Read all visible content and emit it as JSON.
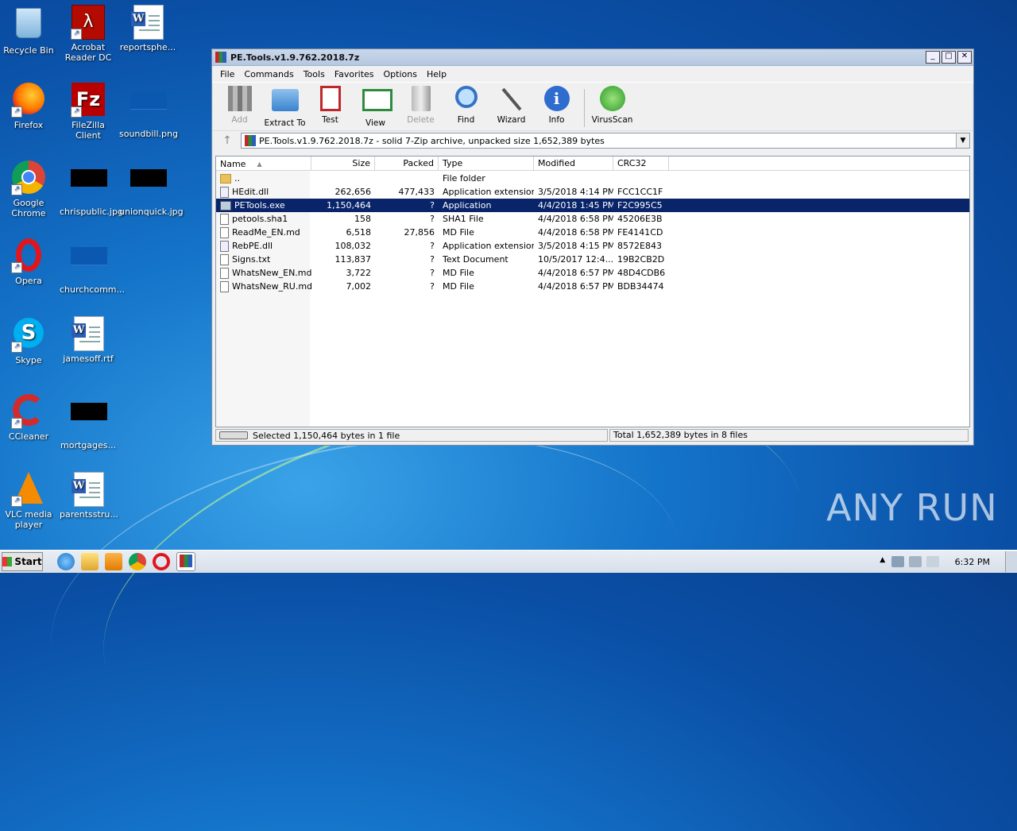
{
  "desktop": {
    "icons": [
      {
        "label": "Recycle Bin"
      },
      {
        "label": "Acrobat Reader DC"
      },
      {
        "label": "reportsphe..."
      },
      {
        "label": "Firefox"
      },
      {
        "label": "FileZilla Client"
      },
      {
        "label": "soundbill.png"
      },
      {
        "label": "Google Chrome"
      },
      {
        "label": "chrispublic.jpg"
      },
      {
        "label": "unionquick.jpg"
      },
      {
        "label": "Opera"
      },
      {
        "label": "churchcomm..."
      },
      {
        "label": "Skype"
      },
      {
        "label": "jamesoff.rtf"
      },
      {
        "label": "CCleaner"
      },
      {
        "label": "mortgages..."
      },
      {
        "label": "VLC media player"
      },
      {
        "label": "parentsstru..."
      }
    ]
  },
  "window": {
    "title": "PE.Tools.v1.9.762.2018.7z",
    "menu": [
      "File",
      "Commands",
      "Tools",
      "Favorites",
      "Options",
      "Help"
    ],
    "toolbar": [
      "Add",
      "Extract To",
      "Test",
      "View",
      "Delete",
      "Find",
      "Wizard",
      "Info",
      "VirusScan"
    ],
    "address": "PE.Tools.v1.9.762.2018.7z - solid 7-Zip archive, unpacked size 1,652,389 bytes",
    "columns": [
      "Name",
      "Size",
      "Packed",
      "Type",
      "Modified",
      "CRC32"
    ],
    "files": [
      {
        "name": "..",
        "size": "",
        "packed": "",
        "type": "File folder",
        "modified": "",
        "crc": ""
      },
      {
        "name": "HEdit.dll",
        "size": "262,656",
        "packed": "477,433",
        "type": "Application extension",
        "modified": "3/5/2018 4:14 PM",
        "crc": "FCC1CC1F"
      },
      {
        "name": "PETools.exe",
        "size": "1,150,464",
        "packed": "?",
        "type": "Application",
        "modified": "4/4/2018 1:45 PM",
        "crc": "F2C995C5"
      },
      {
        "name": "petools.sha1",
        "size": "158",
        "packed": "?",
        "type": "SHA1 File",
        "modified": "4/4/2018 6:58 PM",
        "crc": "45206E3B"
      },
      {
        "name": "ReadMe_EN.md",
        "size": "6,518",
        "packed": "27,856",
        "type": "MD File",
        "modified": "4/4/2018 6:58 PM",
        "crc": "FE4141CD"
      },
      {
        "name": "RebPE.dll",
        "size": "108,032",
        "packed": "?",
        "type": "Application extension",
        "modified": "3/5/2018 4:15 PM",
        "crc": "8572E843"
      },
      {
        "name": "Signs.txt",
        "size": "113,837",
        "packed": "?",
        "type": "Text Document",
        "modified": "10/5/2017 12:4...",
        "crc": "19B2CB2D"
      },
      {
        "name": "WhatsNew_EN.md",
        "size": "3,722",
        "packed": "?",
        "type": "MD File",
        "modified": "4/4/2018 6:57 PM",
        "crc": "48D4CDB6"
      },
      {
        "name": "WhatsNew_RU.md",
        "size": "7,002",
        "packed": "?",
        "type": "MD File",
        "modified": "4/4/2018 6:57 PM",
        "crc": "BDB34474"
      }
    ],
    "status_left": "Selected 1,150,464 bytes in 1 file",
    "status_right": "Total 1,652,389 bytes in 8 files"
  },
  "taskbar": {
    "start_label": "Start",
    "clock": "6:32 PM"
  },
  "watermark": "ANY RUN"
}
